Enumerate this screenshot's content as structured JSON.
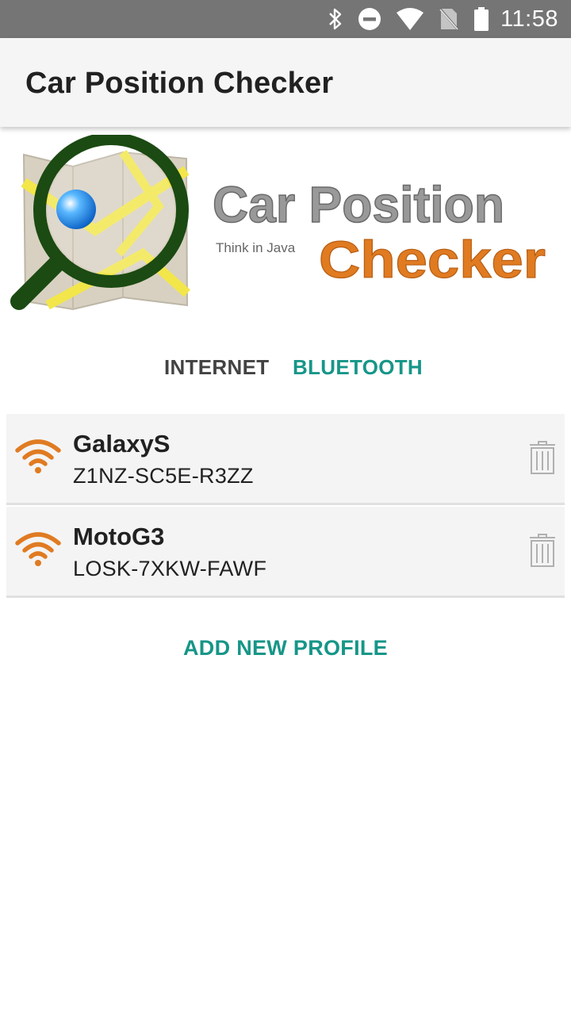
{
  "status_bar": {
    "time": "11:58",
    "icons": [
      "bluetooth-icon",
      "do-not-disturb-icon",
      "wifi-signal-icon",
      "no-sim-icon",
      "battery-icon"
    ]
  },
  "app_bar": {
    "title": "Car Position Checker"
  },
  "banner": {
    "logo_line1": "Car Position",
    "logo_line2": "Checker",
    "tagline": "Think in Java"
  },
  "tabs": [
    {
      "label": "INTERNET",
      "selected": false
    },
    {
      "label": "BLUETOOTH",
      "selected": true
    }
  ],
  "profiles": [
    {
      "name": "GalaxyS",
      "code": "Z1NZ-SC5E-R3ZZ",
      "icon": "wifi-icon"
    },
    {
      "name": "MotoG3",
      "code": "LOSK-7XKW-FAWF",
      "icon": "wifi-icon"
    }
  ],
  "add_button": {
    "label": "ADD NEW PROFILE"
  },
  "colors": {
    "accent": "#169688",
    "status_bar": "#757575",
    "app_bar": "#f5f5f5",
    "wifi_orange": "#e07b22"
  }
}
